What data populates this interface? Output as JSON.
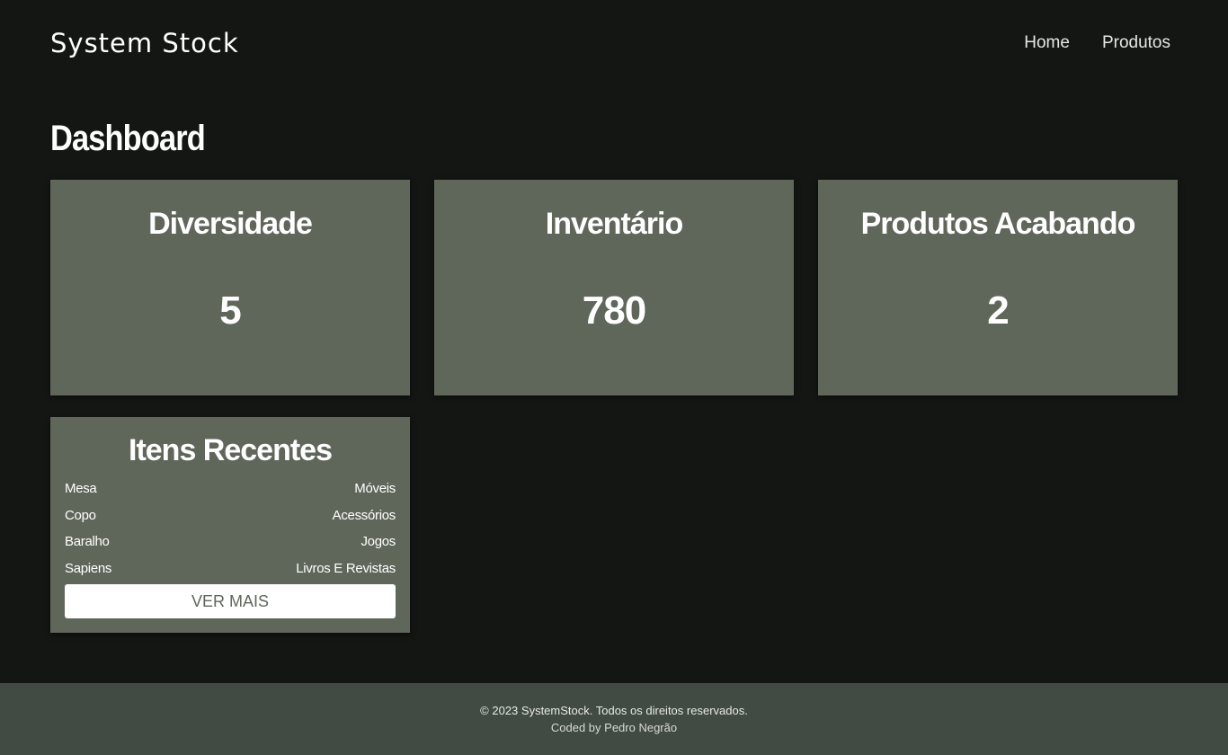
{
  "header": {
    "brand": "System Stock",
    "nav": [
      {
        "label": "Home"
      },
      {
        "label": "Produtos"
      }
    ]
  },
  "main": {
    "title": "Dashboard",
    "stats": [
      {
        "title": "Diversidade",
        "value": "5"
      },
      {
        "title": "Inventário",
        "value": "780"
      },
      {
        "title": "Produtos Acabando",
        "value": "2"
      }
    ],
    "recent": {
      "title": "Itens Recentes",
      "items": [
        {
          "name": "Mesa",
          "category": "Móveis"
        },
        {
          "name": "Copo",
          "category": "Acessórios"
        },
        {
          "name": "Baralho",
          "category": "Jogos"
        },
        {
          "name": "Sapiens",
          "category": "Livros E Revistas"
        }
      ],
      "button_label": "VER MAIS"
    }
  },
  "footer": {
    "copyright": "© 2023 SystemStock. Todos os direitos reservados.",
    "credit": "Coded by Pedro Negrão"
  },
  "colors": {
    "background": "#141614",
    "card": "#5f675b",
    "footer": "#414b43",
    "button": "#ffffff"
  }
}
